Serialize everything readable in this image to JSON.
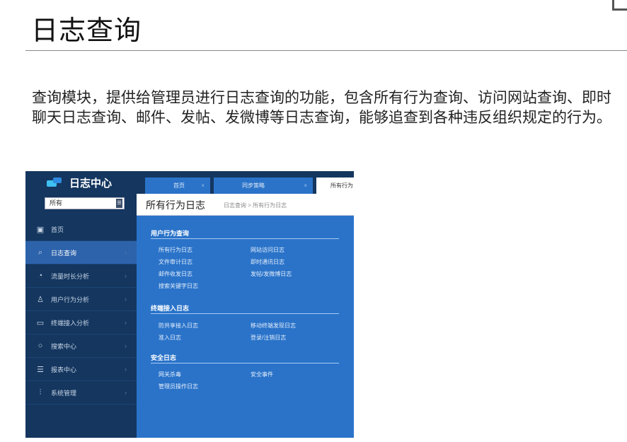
{
  "page": {
    "title": "日志查询",
    "description": "查询模块，提供给管理员进行日志查询的功能，包含所有行为查询、访问网站查询、即时聊天日志查询、邮件、发帖、发微博等日志查询，能够追查到各种违反组织规定的行为。"
  },
  "app": {
    "logo_text": "日志中心",
    "select_value": "所有",
    "nav": [
      {
        "label": "首页",
        "icon": "home-icon"
      },
      {
        "label": "日志查询",
        "icon": "log-search-icon"
      },
      {
        "label": "流量时长分析",
        "icon": "pie-chart-icon"
      },
      {
        "label": "用户行为分析",
        "icon": "user-icon"
      },
      {
        "label": "终端接入分析",
        "icon": "monitor-icon"
      },
      {
        "label": "搜索中心",
        "icon": "search-icon"
      },
      {
        "label": "报表中心",
        "icon": "report-icon"
      },
      {
        "label": "系统管理",
        "icon": "settings-sliders-icon"
      }
    ],
    "active_nav": 1,
    "tabs": [
      {
        "label": "首页",
        "close": "×"
      },
      {
        "label": "同步策略",
        "close": "×"
      },
      {
        "label": "所有行为"
      }
    ],
    "header": {
      "title": "所有行为日志",
      "breadcrumb": "日志查询 > 所有行为日志"
    },
    "sections": [
      {
        "title": "用户行为查询",
        "links": [
          [
            "所有行为日志",
            "网站访问日志"
          ],
          [
            "文件审计日志",
            "即时通讯日志"
          ],
          [
            "邮件收发日志",
            "发帖/发微博日志"
          ],
          [
            "搜索关键字日志",
            ""
          ]
        ]
      },
      {
        "title": "终端接入日志",
        "links": [
          [
            "防共享接入日志",
            "移动终端发现日志"
          ],
          [
            "准入日志",
            "登录/注销日志"
          ]
        ]
      },
      {
        "title": "安全日志",
        "links": [
          [
            "网关杀毒",
            "安全事件"
          ],
          [
            "管理员操作日志",
            ""
          ]
        ]
      }
    ]
  }
}
